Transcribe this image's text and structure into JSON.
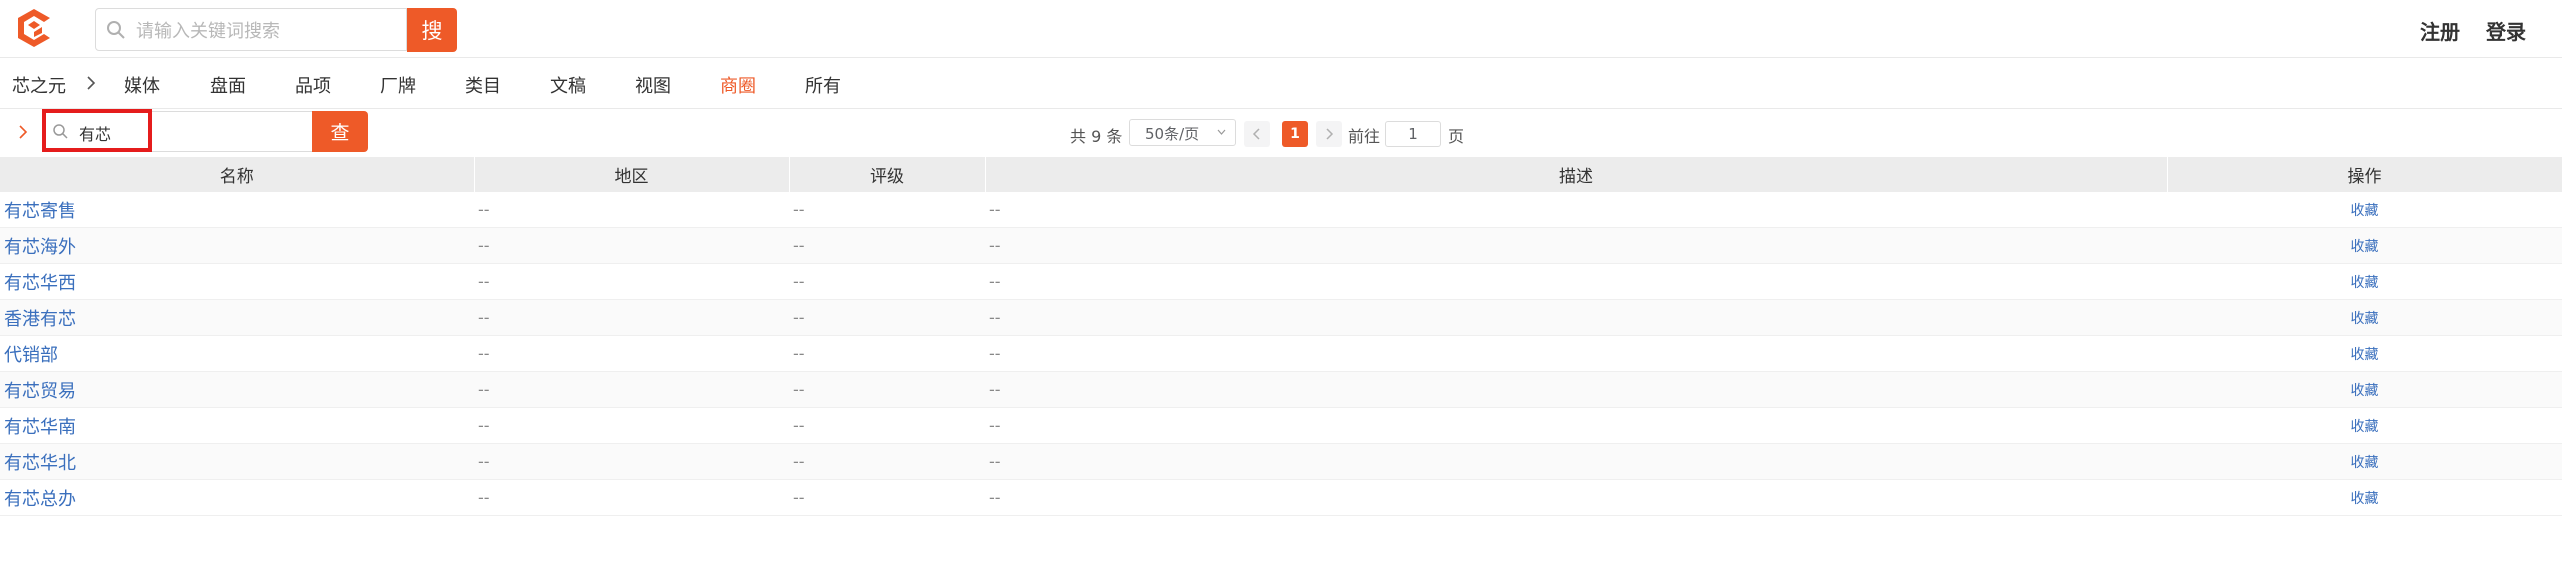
{
  "header": {
    "search_placeholder": "请输入关键词搜索",
    "search_button": "搜",
    "register": "注册",
    "login": "登录"
  },
  "nav": {
    "brand": "芯之元",
    "items": [
      {
        "label": "媒体"
      },
      {
        "label": "盘面"
      },
      {
        "label": "品项"
      },
      {
        "label": "厂牌"
      },
      {
        "label": "类目"
      },
      {
        "label": "文稿"
      },
      {
        "label": "视图"
      },
      {
        "label": "商圈",
        "active": true
      },
      {
        "label": "所有"
      }
    ]
  },
  "toolbar": {
    "search_value": "有芯",
    "query_button": "查"
  },
  "pager": {
    "total_text": "共 9 条",
    "page_size": "50条/页",
    "current_page": "1",
    "goto_label": "前往",
    "goto_value": "1",
    "unit": "页"
  },
  "table": {
    "columns": [
      "名称",
      "地区",
      "评级",
      "描述",
      "操作"
    ],
    "rows": [
      {
        "name": "有芯寄售",
        "region": "--",
        "rating": "--",
        "desc": "--",
        "action": "收藏"
      },
      {
        "name": "有芯海外",
        "region": "--",
        "rating": "--",
        "desc": "--",
        "action": "收藏"
      },
      {
        "name": "有芯华西",
        "region": "--",
        "rating": "--",
        "desc": "--",
        "action": "收藏"
      },
      {
        "name": "香港有芯",
        "region": "--",
        "rating": "--",
        "desc": "--",
        "action": "收藏"
      },
      {
        "name": "代销部",
        "region": "--",
        "rating": "--",
        "desc": "--",
        "action": "收藏"
      },
      {
        "name": "有芯贸易",
        "region": "--",
        "rating": "--",
        "desc": "--",
        "action": "收藏"
      },
      {
        "name": "有芯华南",
        "region": "--",
        "rating": "--",
        "desc": "--",
        "action": "收藏"
      },
      {
        "name": "有芯华北",
        "region": "--",
        "rating": "--",
        "desc": "--",
        "action": "收藏"
      },
      {
        "name": "有芯总办",
        "region": "--",
        "rating": "--",
        "desc": "--",
        "action": "收藏"
      }
    ]
  },
  "colors": {
    "accent": "#ee5a28",
    "link": "#3a6fbd",
    "highlight": "#e51c1c"
  }
}
